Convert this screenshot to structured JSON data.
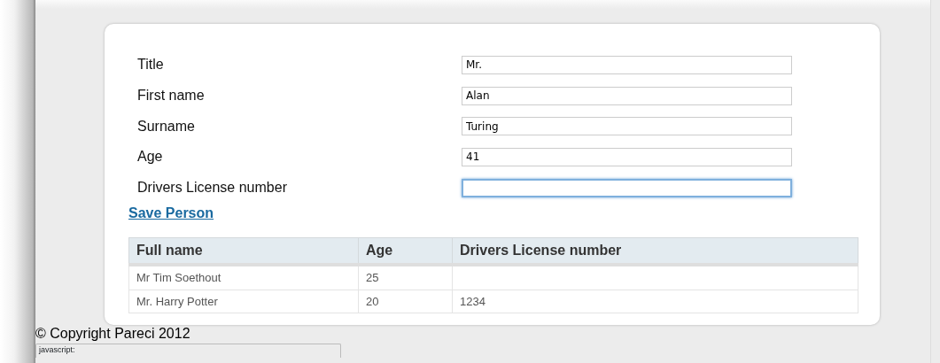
{
  "form": {
    "fields": [
      {
        "label": "Title",
        "value": "Mr.",
        "focused": false
      },
      {
        "label": "First name",
        "value": "Alan",
        "focused": false
      },
      {
        "label": "Surname",
        "value": "Turing",
        "focused": false
      },
      {
        "label": "Age",
        "value": "41",
        "focused": false
      },
      {
        "label": "Drivers License number",
        "focused": true
      }
    ],
    "save_link": "Save Person"
  },
  "table": {
    "columns": [
      "Full name",
      "Age",
      "Drivers License number"
    ],
    "rows": [
      [
        "Mr Tim Soethout",
        "25",
        null
      ],
      [
        "Mr. Harry Potter",
        "20",
        "1234"
      ]
    ]
  },
  "footer": "© Copyright Pareci 2012",
  "status_bar": "javascript:"
}
